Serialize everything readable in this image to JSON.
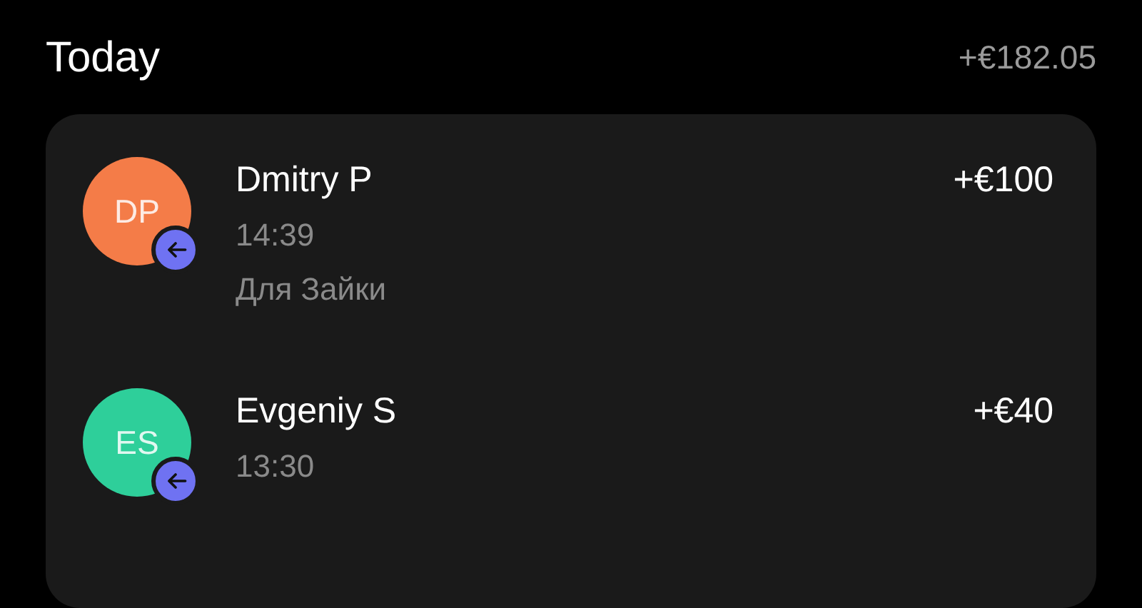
{
  "section": {
    "title": "Today",
    "total": "+€182.05"
  },
  "transactions": [
    {
      "initials": "DP",
      "color": "#f47c48",
      "kind": "incoming",
      "name": "Dmitry P",
      "time": "14:39",
      "note": "Для Зайки",
      "amount": "+€100"
    },
    {
      "initials": "ES",
      "color": "#2ecf9a",
      "kind": "incoming",
      "name": "Evgeniy S",
      "time": "13:30",
      "amount": "+€40"
    }
  ]
}
